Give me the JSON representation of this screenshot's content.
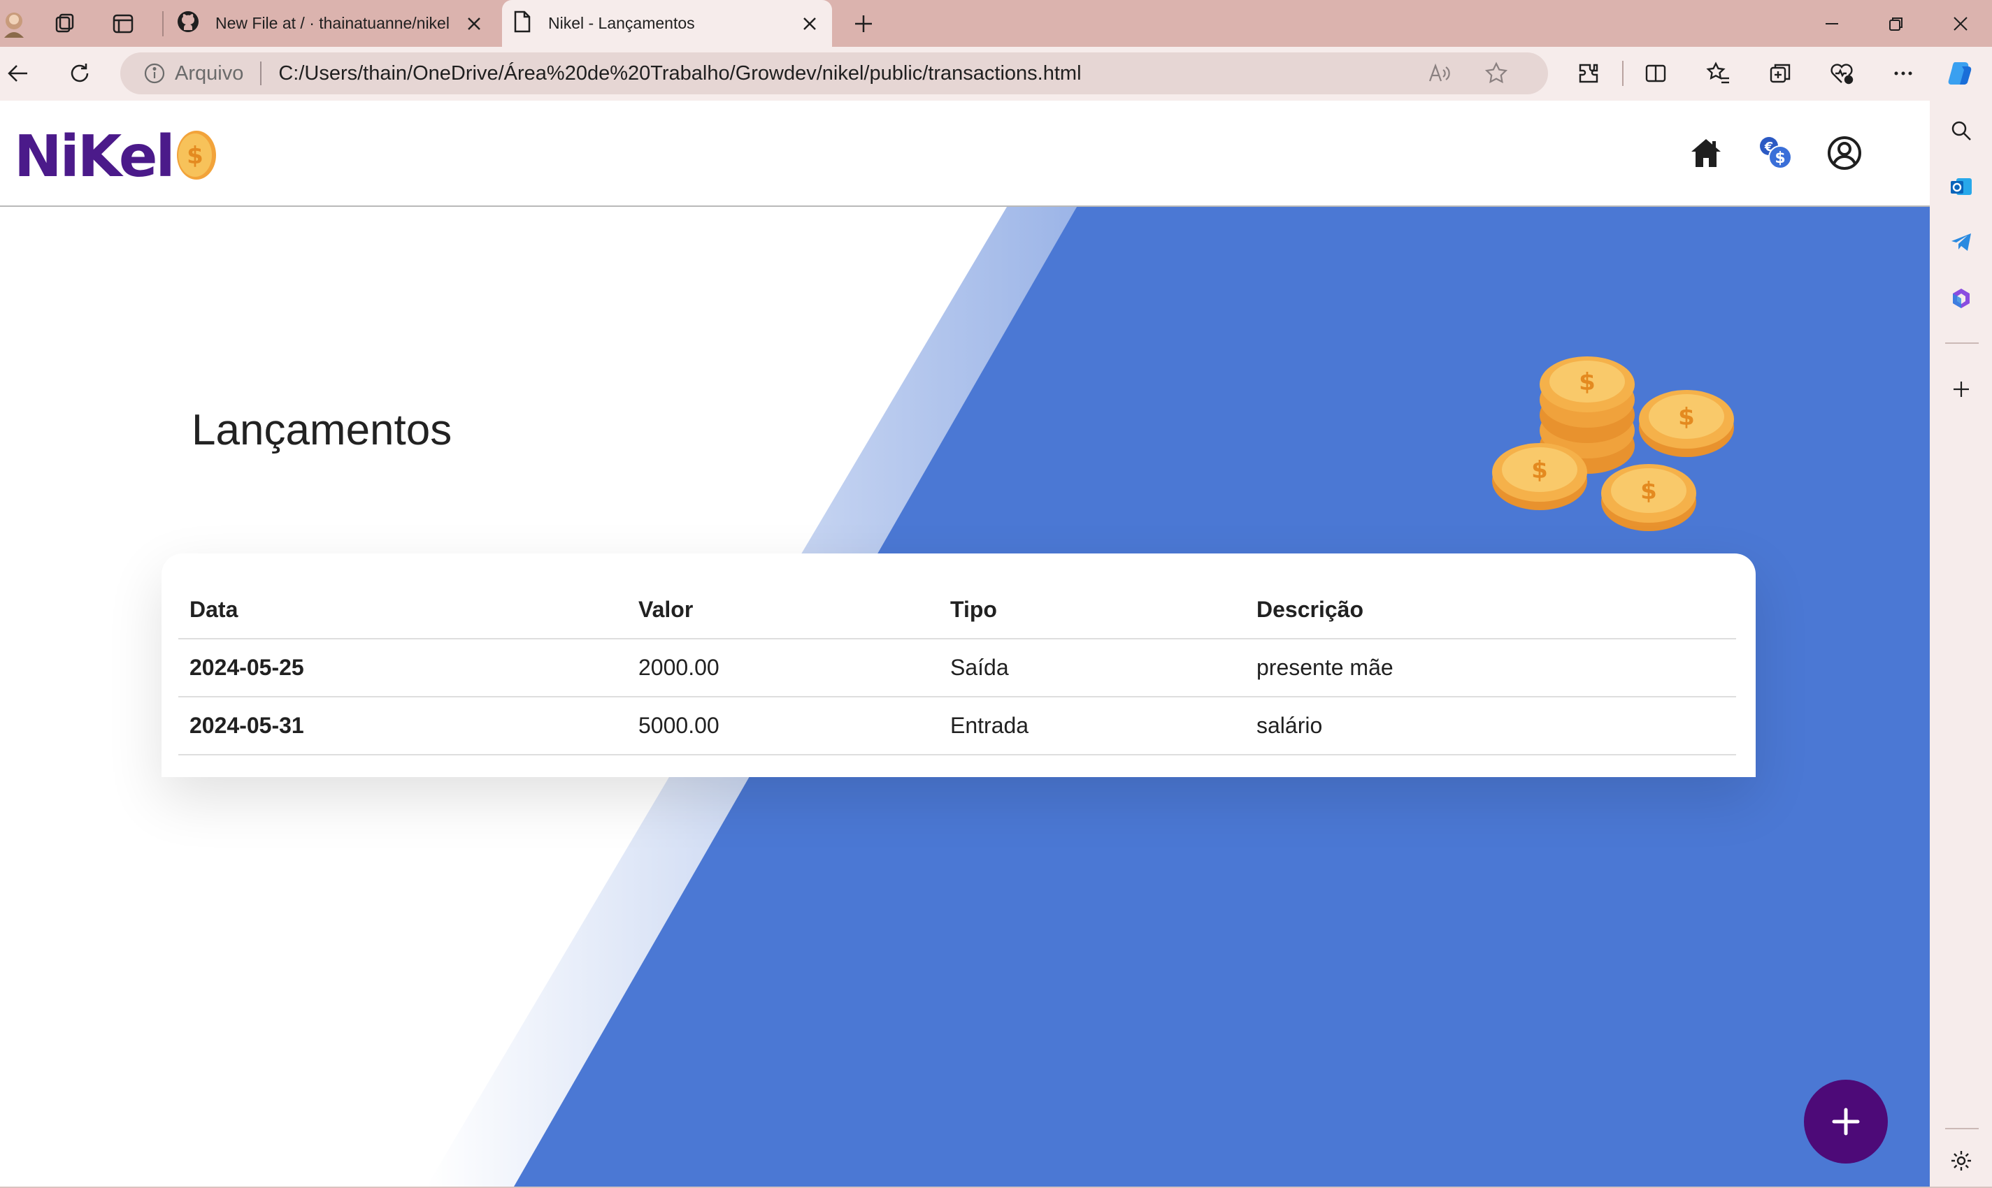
{
  "browser": {
    "tabs": [
      {
        "title": "New File at / · thainatuanne/nikel",
        "active": false
      },
      {
        "title": "Nikel - Lançamentos",
        "active": true
      }
    ],
    "address": {
      "security_label": "Arquivo",
      "url": "C:/Users/thain/OneDrive/Área%20de%20Trabalho/Growdev/nikel/public/transactions.html"
    }
  },
  "site": {
    "logo_text": "NiKel",
    "page_title": "Lançamentos"
  },
  "table": {
    "headers": {
      "date": "Data",
      "value": "Valor",
      "type": "Tipo",
      "description": "Descrição"
    },
    "rows": [
      {
        "date": "2024-05-25",
        "value": "2000.00",
        "type": "Saída",
        "description": "presente mãe"
      },
      {
        "date": "2024-05-31",
        "value": "5000.00",
        "type": "Entrada",
        "description": "salário"
      }
    ]
  },
  "colors": {
    "tabbar": "#dbb3ae",
    "toolbar": "#f6eceb",
    "hero_blue": "#4b78d4",
    "logo_purple": "#4b1a8a",
    "fab_purple": "#4d0a78",
    "coin_gold": "#f5b14a"
  }
}
